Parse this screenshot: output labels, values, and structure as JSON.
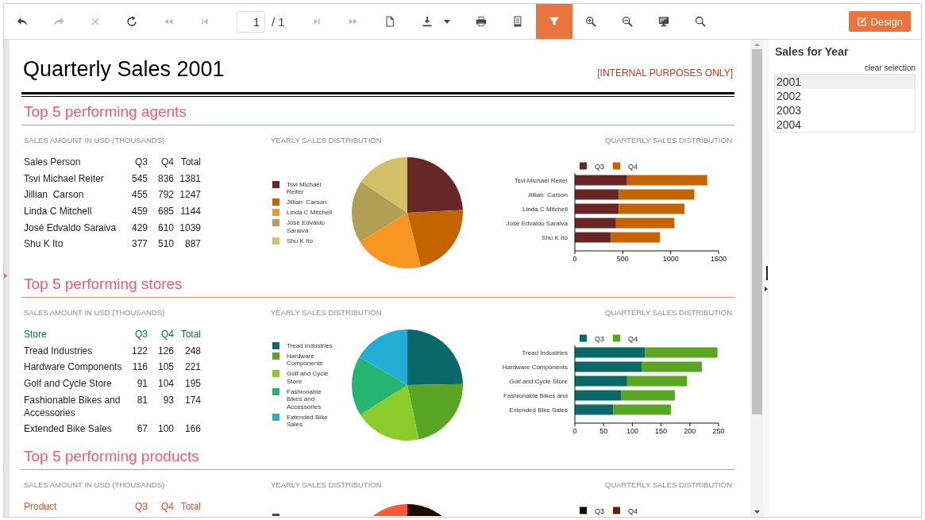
{
  "toolbar": {
    "buttons_left": [
      {
        "kind": "undo",
        "disabled": false,
        "selected": false
      },
      {
        "kind": "redo",
        "disabled": true,
        "selected": false
      },
      {
        "kind": "stop",
        "disabled": true,
        "selected": false
      },
      {
        "kind": "refresh",
        "disabled": false,
        "selected": false
      },
      {
        "kind": "first",
        "disabled": true,
        "selected": false
      },
      {
        "kind": "previous",
        "disabled": true,
        "selected": false
      }
    ],
    "page": {
      "value": "1",
      "total": "/ 1"
    },
    "buttons_right": [
      {
        "kind": "next",
        "disabled": true,
        "selected": false
      },
      {
        "kind": "last",
        "disabled": true,
        "selected": false
      },
      {
        "kind": "preview",
        "disabled": false,
        "selected": false
      },
      {
        "kind": "export",
        "disabled": false,
        "selected": false
      },
      {
        "kind": "print",
        "disabled": false,
        "selected": false
      },
      {
        "kind": "docmap",
        "disabled": false,
        "selected": false
      },
      {
        "kind": "parameters",
        "disabled": false,
        "selected": true
      },
      {
        "kind": "zoomin",
        "disabled": false,
        "selected": false
      },
      {
        "kind": "zoomout",
        "disabled": false,
        "selected": false
      },
      {
        "kind": "zoommode",
        "disabled": false,
        "selected": false
      },
      {
        "kind": "search",
        "disabled": false,
        "selected": false
      }
    ],
    "design_button": {
      "label": "Design"
    }
  },
  "report": {
    "title": "Quarterly Sales 2001",
    "notice": "[INTERNAL PURPOSES ONLY]",
    "sections": [
      {
        "heading": "Top 5 performing agents",
        "table": {
          "title": "SALES AMOUNT IN USD (THOUSANDS)",
          "color": "#262626",
          "columns": [
            "Sales Person",
            "Q3",
            "Q4",
            "Total"
          ],
          "rows": [
            [
              "Tsvi Michael Reiter",
              "545",
              "836",
              "1381"
            ],
            [
              "Jillian  Carson",
              "455",
              "792",
              "1247"
            ],
            [
              "Linda C Mitchell",
              "459",
              "685",
              "1144"
            ],
            [
              "José Edvaldo Saraiva",
              "429",
              "610",
              "1039"
            ],
            [
              "Shu K Ito",
              "377",
              "510",
              "887"
            ]
          ]
        },
        "pie": {
          "title": "YEARLY SALES DISTRIBUTION",
          "chart_data": {
            "type": "pie",
            "legend": "left",
            "categories": [
              "Tsvi Michael Reiter",
              "Jillian  Carson",
              "Linda C Mitchell",
              "José Edvaldo Saraiva",
              "Shu K Ito"
            ],
            "values": [
              24.2,
              21.9,
              20.1,
              18.2,
              15.6
            ],
            "colors": [
              "#672727",
              "#c46300",
              "#f99521",
              "#b1a053",
              "#d4bf69"
            ]
          }
        },
        "bars": {
          "title": "QUARTERLY SALES DISTRIBUTION",
          "chart_data": {
            "type": "bar",
            "orientation": "horizontal",
            "stacked": true,
            "legend": "top",
            "categories": [
              "Tsvi Michael Reiter",
              "Jillian  Carson",
              "Linda C Mitchell",
              "José Edvaldo Saraiva",
              "Shu K Ito"
            ],
            "series": [
              {
                "name": "Q3",
                "color": "#672727",
                "values": [
                  545,
                  455,
                  459,
                  429,
                  377
                ]
              },
              {
                "name": "Q4",
                "color": "#c46300",
                "values": [
                  836,
                  792,
                  685,
                  610,
                  510
                ]
              }
            ],
            "xlim": [
              0,
              1500
            ],
            "xticks": [
              0,
              500,
              1000,
              1500
            ]
          }
        }
      },
      {
        "heading": "Top 5 performing stores",
        "table": {
          "title": "SALES AMOUNT IN USD (THOUSANDS)",
          "color": "#0e6868",
          "columns": [
            "Store",
            "Q3",
            "Q4",
            "Total"
          ],
          "rows": [
            [
              "Tread Industries",
              "122",
              "126",
              "248"
            ],
            [
              "Hardware Components",
              "116",
              "105",
              "221"
            ],
            [
              "Golf and Cycle Store",
              "91",
              "104",
              "195"
            ],
            [
              "Fashionable Bikes and Accessories",
              "81",
              "93",
              "174"
            ],
            [
              "Extended Bike Sales",
              "67",
              "100",
              "166"
            ]
          ]
        },
        "pie": {
          "title": "YEARLY SALES DISTRIBUTION",
          "chart_data": {
            "type": "pie",
            "legend": "left",
            "categories": [
              "Tread Industries",
              "Hardware Components",
              "Golf and Cycle Store",
              "Fashionable Bikes and Accessories",
              "Extended Bike Sales"
            ],
            "values": [
              24.7,
              22.0,
              19.4,
              17.3,
              16.6
            ],
            "colors": [
              "#0b6868",
              "#58a624",
              "#8bcb2b",
              "#26b473",
              "#23acd6"
            ]
          }
        },
        "bars": {
          "title": "QUARTERLY SALES DISTRIBUTION",
          "chart_data": {
            "type": "bar",
            "orientation": "horizontal",
            "stacked": true,
            "legend": "top",
            "categories": [
              "Tread Industries",
              "Hardware Components",
              "Golf and Cycle Store",
              "Fashionable Bikes and",
              "Extended Bike Sales"
            ],
            "series": [
              {
                "name": "Q3",
                "color": "#0b6868",
                "values": [
                  122,
                  116,
                  91,
                  81,
                  67
                ]
              },
              {
                "name": "Q4",
                "color": "#58a624",
                "values": [
                  126,
                  105,
                  104,
                  93,
                  100
                ]
              }
            ],
            "xlim": [
              0,
              250
            ],
            "xticks": [
              0,
              50,
              100,
              150,
              200,
              250
            ]
          }
        }
      },
      {
        "heading": "Top 5 performing products",
        "table": {
          "title": "SALES AMOUNT IN USD (THOUSANDS)",
          "color": "#ea4a2c",
          "columns": [
            "Product",
            "Q3",
            "Q4",
            "Total"
          ]
        },
        "pie": {
          "title": "YEARLY SALES DISTRIBUTION"
        },
        "bars": {
          "title": "QUARTERLY SALES DISTRIBUTION",
          "legend": [
            {
              "label": "Q3",
              "color": "#1e0a03"
            },
            {
              "label": "Q4",
              "color": "#5e2211"
            }
          ]
        }
      }
    ]
  },
  "parameter_panel": {
    "title": "Sales for Year",
    "clear_link": "clear selection",
    "options": [
      {
        "label": "2001",
        "selected": true
      },
      {
        "label": "2002",
        "selected": false
      },
      {
        "label": "2003",
        "selected": false
      },
      {
        "label": "2004",
        "selected": false
      }
    ]
  }
}
